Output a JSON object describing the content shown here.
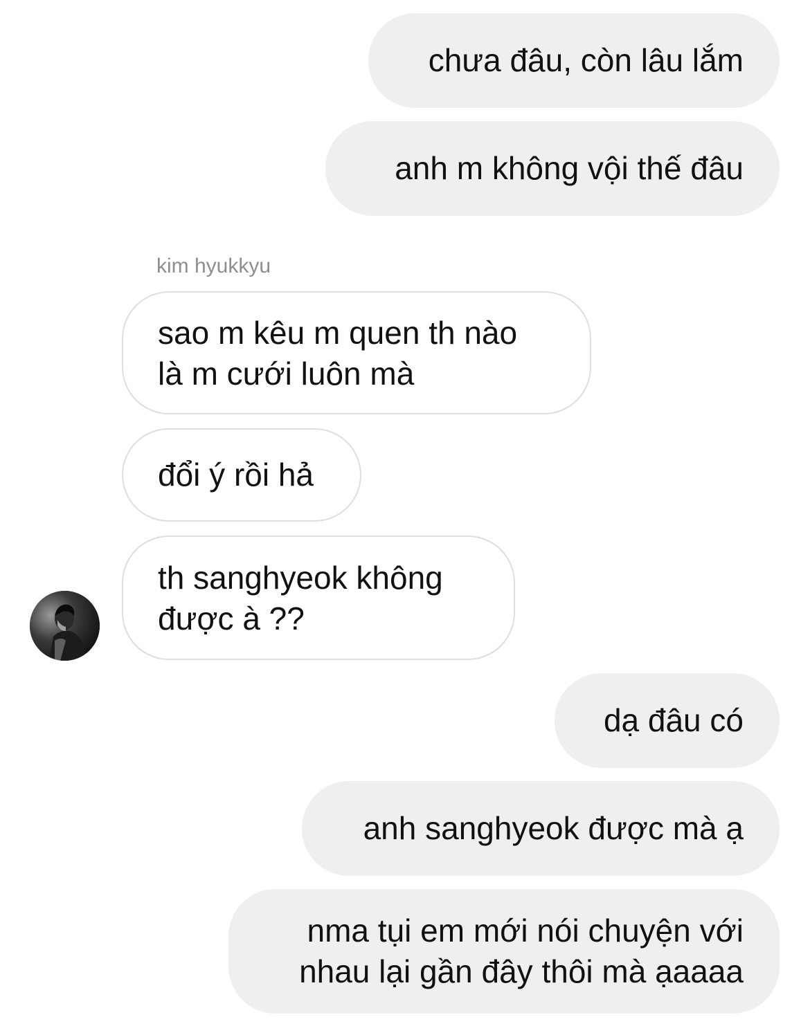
{
  "chat": {
    "sender_name": "kim hyukkyu",
    "messages": [
      {
        "side": "outgoing",
        "lines": [
          "chưa đâu, còn lâu lắm"
        ]
      },
      {
        "side": "outgoing",
        "lines": [
          "anh m không vội thế đâu"
        ]
      },
      {
        "side": "incoming",
        "lines": [
          "sao m kêu m quen th nào",
          "là m cưới luôn mà"
        ]
      },
      {
        "side": "incoming",
        "lines": [
          "đổi ý rồi hả"
        ]
      },
      {
        "side": "incoming",
        "lines": [
          "th sanghyeok không",
          "được à ??"
        ]
      },
      {
        "side": "outgoing",
        "lines": [
          "dạ đâu có"
        ]
      },
      {
        "side": "outgoing",
        "lines": [
          "anh sanghyeok được mà ạ"
        ]
      },
      {
        "side": "outgoing",
        "lines": [
          "nma tụi em mới nói chuyện với",
          "nhau lại gần đây thôi mà ạaaaa"
        ]
      }
    ]
  },
  "colors": {
    "outgoing_bubble": "#efefef",
    "incoming_border": "#dedede",
    "sender_name": "#8e8e8e"
  },
  "icons": {
    "avatar": "contact-avatar-photo"
  }
}
